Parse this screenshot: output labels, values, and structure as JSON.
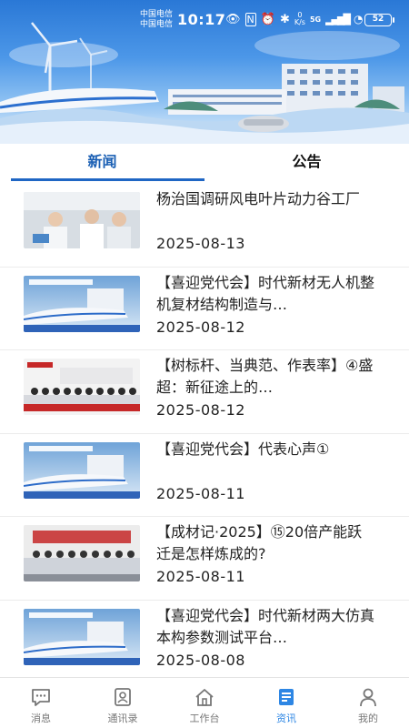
{
  "status_bar": {
    "carrier_1": "中国电信",
    "carrier_2": "中国电信",
    "time": "10:17",
    "net_speed_value": "0",
    "net_speed_unit": "K/s",
    "network": "5G",
    "battery": "52"
  },
  "tabs": [
    {
      "label": "新闻",
      "active": true
    },
    {
      "label": "公告",
      "active": false
    }
  ],
  "news": [
    {
      "title": "杨治国调研风电叶片动力谷工厂",
      "date": "2025-08-13",
      "thumb": "factory-visit"
    },
    {
      "title": "【喜迎党代会】时代新材无人机整机复材结构制造与…",
      "date": "2025-08-12",
      "thumb": "train-banner"
    },
    {
      "title": "【树标杆、当典范、作表率】④盛超：新征途上的…",
      "date": "2025-08-12",
      "thumb": "group-photo"
    },
    {
      "title": "【喜迎党代会】代表心声①",
      "date": "2025-08-11",
      "thumb": "train-banner"
    },
    {
      "title": "【成材记·2025】⑮20倍产能跃迁是怎样炼成的?",
      "date": "2025-08-11",
      "thumb": "group-photo"
    },
    {
      "title": "【喜迎党代会】时代新材两大仿真本构参数测试平台…",
      "date": "2025-08-08",
      "thumb": "train-banner"
    }
  ],
  "bottom_nav": [
    {
      "label": "消息",
      "icon": "message-icon",
      "active": false
    },
    {
      "label": "通讯录",
      "icon": "contacts-icon",
      "active": false
    },
    {
      "label": "工作台",
      "icon": "workbench-icon",
      "active": false
    },
    {
      "label": "资讯",
      "icon": "news-icon",
      "active": true
    },
    {
      "label": "我的",
      "icon": "profile-icon",
      "active": false
    }
  ],
  "colors": {
    "accent": "#2d86e4",
    "tab_active": "#1a5fb4",
    "banner_sky": "#2a78d6"
  }
}
